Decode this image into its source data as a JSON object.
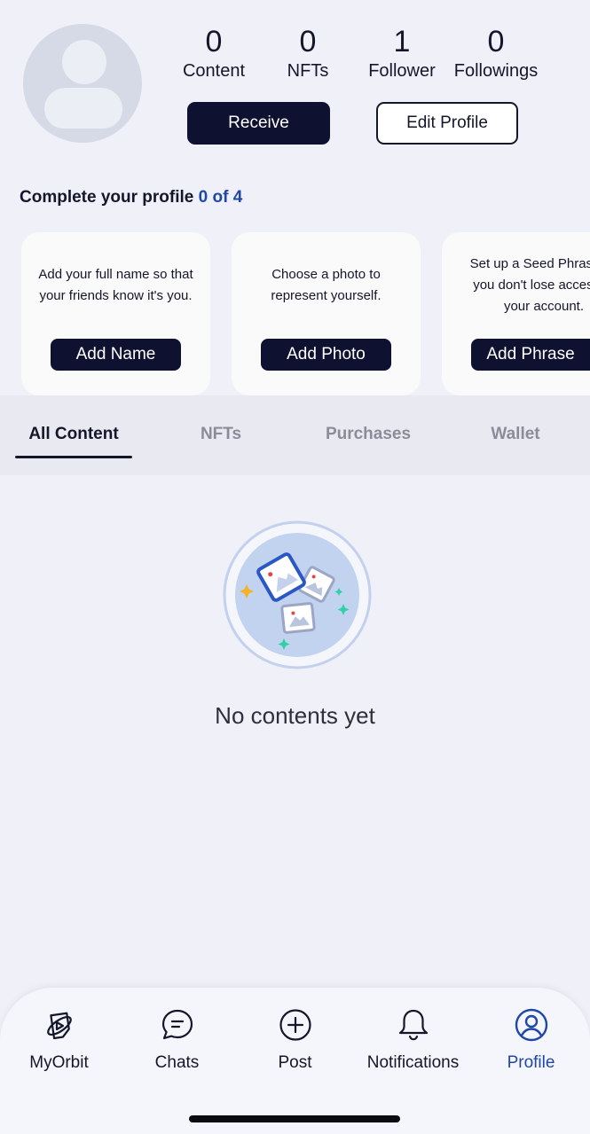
{
  "profile": {
    "stats": [
      {
        "value": "0",
        "label": "Content"
      },
      {
        "value": "0",
        "label": "NFTs"
      },
      {
        "value": "1",
        "label": "Follower"
      },
      {
        "value": "0",
        "label": "Followings"
      }
    ],
    "receive_label": "Receive",
    "edit_label": "Edit Profile"
  },
  "complete": {
    "title": "Complete your profile",
    "progress": "0 of 4",
    "cards": [
      {
        "desc": "Add your full name so that\nyour friends know it's you.",
        "button": "Add Name"
      },
      {
        "desc": "Choose a photo to\nrepresent yourself.",
        "button": "Add Photo"
      },
      {
        "desc": "Set up a Seed Phrase so\nyou don't lose access to\nyour account.",
        "button": "Add Phrase"
      }
    ]
  },
  "tabs": [
    "All Content",
    "NFTs",
    "Purchases",
    "Wallet"
  ],
  "active_tab": "All Content",
  "empty_state": {
    "text": "No contents yet",
    "icon": "images-illustration-icon"
  },
  "bottom_nav": [
    {
      "label": "MyOrbit",
      "icon": "orbit-icon"
    },
    {
      "label": "Chats",
      "icon": "chat-bubble-icon"
    },
    {
      "label": "Post",
      "icon": "plus-circle-icon"
    },
    {
      "label": "Notifications",
      "icon": "bell-icon"
    },
    {
      "label": "Profile",
      "icon": "user-circle-icon"
    }
  ],
  "active_nav": "Profile",
  "colors": {
    "dark": "#0e1130",
    "accent": "#1f47a8",
    "background": "#f0f0f8"
  }
}
